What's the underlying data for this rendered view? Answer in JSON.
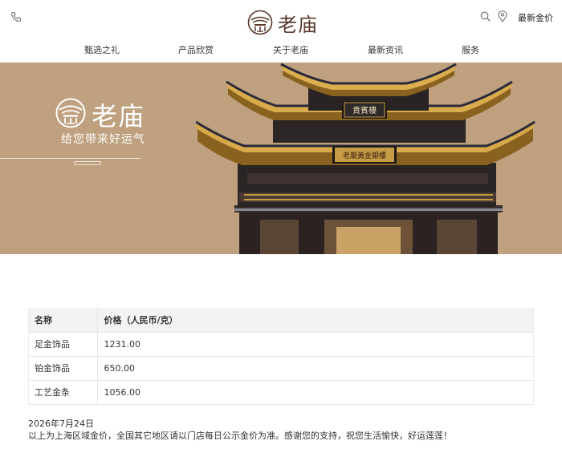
{
  "header": {
    "brand_name": "老庙",
    "top_link": "最新金价",
    "icons": [
      "phone-icon",
      "search-icon",
      "location-pin-icon",
      "temple-logo-icon"
    ]
  },
  "nav": {
    "items": [
      {
        "label": "甄选之礼"
      },
      {
        "label": "产品欣赏"
      },
      {
        "label": "关于老庙"
      },
      {
        "label": "最新资讯"
      },
      {
        "label": "服务"
      }
    ]
  },
  "banner": {
    "brand_name": "老庙",
    "slogan": "给您带来好运气",
    "sign_top": "貴賓樓",
    "sign_main": "老廟黃金銀樓",
    "background_color": "#bfa17f"
  },
  "price_table": {
    "headers": [
      "名称",
      "价格（人民币/克）"
    ],
    "rows": [
      {
        "name": "足金饰品",
        "price": "1231.00"
      },
      {
        "name": "铂金饰品",
        "price": "650.00"
      },
      {
        "name": "工艺金条",
        "price": "1056.00"
      }
    ]
  },
  "footer_note": {
    "date": "2026年7月24日",
    "text": "以上为上海区域金价，全国其它地区请以门店每日公示金价为准。感谢您的支持，祝您生活愉快，好运莲莲！"
  },
  "colors": {
    "brand_brown": "#5a3a2e",
    "banner_tan": "#bfa17f"
  }
}
